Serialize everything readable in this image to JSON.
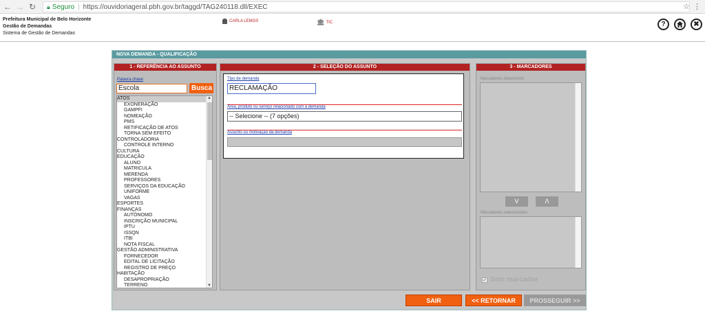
{
  "browser": {
    "secure_label": "Seguro",
    "url": "https://ouvidoriageral.pbh.gov.br/taggd/TAG240118.dll/EXEC"
  },
  "header": {
    "org_line1": "Prefeitura Municipal de Belo Horizonte",
    "org_line2": "Gestão de Demandas",
    "org_line3": "Sistema de Gestão de Demandas",
    "user_name": "CARLA LEMOS",
    "tic_label": "TIC",
    "help_label": "?",
    "close_label": "✖"
  },
  "form": {
    "title": "NOVA DEMANDA - QUALIFICAÇÃO",
    "panel1": {
      "title": "1 - REFERÊNCIA AO ASSUNTO",
      "keyword_label": "Palavra chave",
      "keyword_value": "Escola",
      "search_button": "Busca",
      "tree": [
        {
          "label": "ATOS",
          "level": 0,
          "selected": true
        },
        {
          "label": "EXONERAÇÃO",
          "level": 1
        },
        {
          "label": "GAMPFI",
          "level": 1
        },
        {
          "label": "NOMEAÇÃO",
          "level": 1
        },
        {
          "label": "PMS",
          "level": 1
        },
        {
          "label": "RETIFICAÇÃO DE ATOS",
          "level": 1
        },
        {
          "label": "TORNA SEM EFEITO",
          "level": 1
        },
        {
          "label": "CONTROLADORIA",
          "level": 0
        },
        {
          "label": "CONTROLE INTERNO",
          "level": 1
        },
        {
          "label": "CULTURA",
          "level": 0
        },
        {
          "label": "EDUCAÇÃO",
          "level": 0
        },
        {
          "label": "ALUNO",
          "level": 1
        },
        {
          "label": "MATRICULA",
          "level": 1
        },
        {
          "label": "MERENDA",
          "level": 1
        },
        {
          "label": "PROFESSORES",
          "level": 1
        },
        {
          "label": "SERVIÇOS DA EDUCAÇÃO",
          "level": 1
        },
        {
          "label": "UNIFORME",
          "level": 1
        },
        {
          "label": "VAGAS",
          "level": 1
        },
        {
          "label": "ESPORTES",
          "level": 0
        },
        {
          "label": "FINANÇAS",
          "level": 0
        },
        {
          "label": "AUTÔNOMO",
          "level": 1
        },
        {
          "label": "INSCRIÇÃO MUNICIPAL",
          "level": 1
        },
        {
          "label": "IPTU",
          "level": 1
        },
        {
          "label": "ISSQN",
          "level": 1
        },
        {
          "label": "ITBI",
          "level": 1
        },
        {
          "label": "NOTA FISCAL",
          "level": 1
        },
        {
          "label": "GESTÃO ADMINISTRATIVA",
          "level": 0
        },
        {
          "label": "FORNECEDOR",
          "level": 1
        },
        {
          "label": "EDITAL DE LICITAÇÃO",
          "level": 1
        },
        {
          "label": "REGISTRO DE PREÇO",
          "level": 1
        },
        {
          "label": "HABITAÇÃO",
          "level": 0
        },
        {
          "label": "DESAPROPRIAÇÃO",
          "level": 1
        },
        {
          "label": "TERRENO",
          "level": 1
        }
      ]
    },
    "panel2": {
      "title": "2 - SELEÇÃO DO ASSUNTO",
      "tipo_label": "Tipo de demanda",
      "tipo_value": "RECLAMAÇÃO",
      "area_label": "Área, produto ou serviço relacionado com a demanda",
      "area_value": "-- Selecione -- (7 opções)",
      "assunto_label": "Assunto ou motivação da demanda",
      "assunto_value": ""
    },
    "panel3": {
      "title": "3 - MARCADORES",
      "available_label": "Marcadores disponíveis",
      "down_button": "V",
      "up_button": "Λ",
      "selected_label": "Marcadores selecionados",
      "no_marker_label": "Sem marcador"
    },
    "buttons": {
      "exit": "SAIR",
      "back": "<< RETORNAR",
      "next": "PROSSEGUIR >>"
    }
  },
  "colors": {
    "frame_title_bg": "#5a9ba0",
    "panel_title_bg": "#b22222",
    "orange": "#f06010",
    "disabled_gray": "#999999"
  }
}
